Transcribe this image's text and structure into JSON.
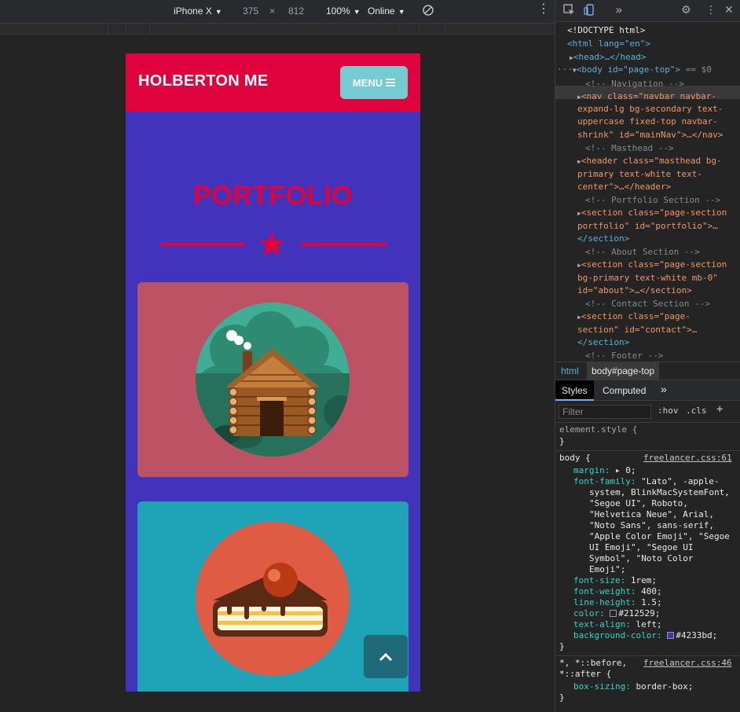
{
  "toolbar": {
    "device": "iPhone X",
    "width": "375",
    "times": "×",
    "height": "812",
    "zoom": "100%",
    "network": "Online"
  },
  "site": {
    "brand": "HOLBERTON ME",
    "menu_label": "MENU",
    "section_title": "PORTFOLIO"
  },
  "colors": {
    "nav": "#e0023c",
    "page_bg": "#4233bd",
    "menu_button": "#74cbd1",
    "card1": "#bd5265",
    "card2": "#1fa3b6"
  },
  "devtools": {
    "dom": {
      "doctype": "<!DOCTYPE html>",
      "html_open": "<html lang=\"en\">",
      "head": "<head>…</head>",
      "body_tag": "<body id=\"page-top\">",
      "body_marker": "== $0",
      "comment_nav": "<!-- Navigation -->",
      "nav_1": "<nav class=\"navbar navbar-",
      "nav_2": "expand-lg bg-secondary text-",
      "nav_3": "uppercase fixed-top navbar-",
      "nav_4": "shrink\" id=\"mainNav\">…</nav>",
      "comment_masthead": "<!-- Masthead -->",
      "header_1": "<header class=\"masthead bg-",
      "header_2": "primary text-white text-",
      "header_3": "center\">…</header>",
      "comment_portfolio": "<!-- Portfolio Section -->",
      "portfolio_1": "<section class=\"page-section",
      "portfolio_2": "portfolio\" id=\"portfolio\">…",
      "portfolio_3": "</section>",
      "comment_about": "<!-- About Section -->",
      "about_1": "<section class=\"page-section",
      "about_2": "bg-primary text-white mb-0\"",
      "about_3": "id=\"about\">…</section>",
      "comment_contact": "<!-- Contact Section -->",
      "contact_1": "<section class=\"page-",
      "contact_2": "section\" id=\"contact\">…",
      "contact_3": "</section>",
      "comment_footer": "<!-- Footer -->"
    },
    "breadcrumb": [
      "html",
      "body#page-top"
    ],
    "tabs": [
      "Styles",
      "Computed"
    ],
    "more_tabs": "»",
    "filter_placeholder": "Filter",
    "hov": ":hov",
    "cls": ".cls",
    "plus": "+",
    "styles": {
      "element_style": "element.style {",
      "close_brace": "}",
      "body_selector": "body {",
      "body_source": "freelancer.css:61",
      "margin_prop": "margin:",
      "margin_val": "▸ 0;",
      "font_family_prop": "font-family:",
      "font_family_lines": [
        "\"Lato\", -apple-",
        "system, BlinkMacSystemFont,",
        "\"Segoe UI\", Roboto,",
        "\"Helvetica Neue\", Arial,",
        "\"Noto Sans\", sans-serif,",
        "\"Apple Color Emoji\", \"Segoe",
        "UI Emoji\", \"Segoe UI",
        "Symbol\", \"Noto Color",
        "Emoji\";"
      ],
      "font_size_prop": "font-size:",
      "font_size_val": "1rem;",
      "font_weight_prop": "font-weight:",
      "font_weight_val": "400;",
      "line_height_prop": "line-height:",
      "line_height_val": "1.5;",
      "color_prop": "color:",
      "color_val": "#212529;",
      "color_swatch": "#212529",
      "text_align_prop": "text-align:",
      "text_align_val": "left;",
      "bg_prop": "background-color:",
      "bg_val": "#4233bd;",
      "bg_swatch": "#4233bd",
      "universal_selector_1": "*, *::before,",
      "universal_selector_2": "*::after {",
      "universal_source": "freelancer.css:46",
      "box_sizing_prop": "box-sizing:",
      "box_sizing_val": "border-box;"
    }
  }
}
